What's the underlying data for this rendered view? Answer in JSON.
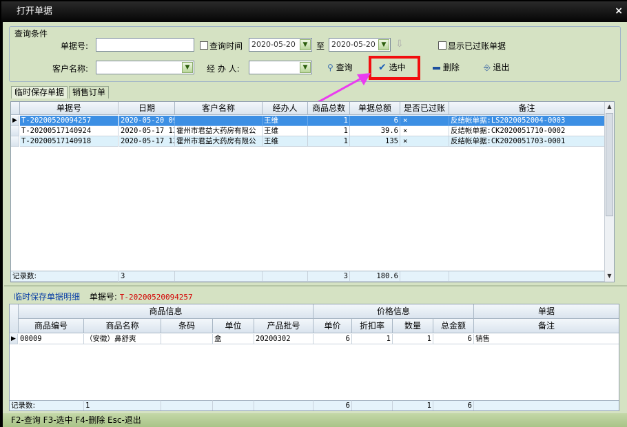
{
  "window": {
    "title": "打开单据",
    "close_glyph": "×"
  },
  "query": {
    "legend": "查询条件",
    "doc_no_label": "单据号:",
    "doc_no_value": "",
    "query_time_label": "查询时间",
    "date_from": "2020-05-20",
    "to_label": "至",
    "date_to": "2020-05-20",
    "show_posted_label": "显示已过账单据",
    "customer_label": "客户名称:",
    "customer_value": "",
    "handler_label": "经 办 人:",
    "handler_value": "",
    "btn_query": "查询",
    "btn_select": "选中",
    "btn_delete": "删除",
    "btn_exit": "退出"
  },
  "tabs": [
    "临时保存单据",
    "销售订单"
  ],
  "top_grid": {
    "headers": [
      "单据号",
      "日期",
      "客户名称",
      "经办人",
      "商品总数",
      "单据总额",
      "是否已过账",
      "备注"
    ],
    "rows": [
      [
        "T-20200520094257",
        "2020-05-20 09",
        "",
        "王维",
        "1",
        "6",
        "×",
        "反结帐单据:LS2020052004-0003"
      ],
      [
        "T-20200517140924",
        "2020-05-17 13",
        "霍州市君益大药房有限公",
        "王维",
        "1",
        "39.6",
        "×",
        "反结帐单据:CK2020051710-0002"
      ],
      [
        "T-20200517140918",
        "2020-05-17 13",
        "霍州市君益大药房有限公",
        "王维",
        "1",
        "135",
        "×",
        "反结帐单据:CK2020051703-0001"
      ]
    ],
    "footer": [
      "记录数:",
      "3",
      "",
      "",
      "3",
      "180.6",
      "",
      ""
    ]
  },
  "detail": {
    "title": "临时保存单据明细",
    "doc_label": "单据号:",
    "doc_value": "T-20200520094257",
    "group_headers": [
      "商品信息",
      "价格信息",
      "单据"
    ],
    "headers": [
      "商品编号",
      "商品名称",
      "条码",
      "单位",
      "产品批号",
      "单价",
      "折扣率",
      "数量",
      "总金额",
      "备注"
    ],
    "rows": [
      [
        "00009",
        "（安徽）鼻舒爽",
        "",
        "盒",
        "20200302",
        "6",
        "1",
        "1",
        "6",
        "销售"
      ]
    ],
    "footer": [
      "记录数:",
      "1",
      "",
      "",
      "",
      "6",
      "",
      "1",
      "6",
      ""
    ]
  },
  "status_bar": "F2-查询 F3-选中 F4-删除 Esc-退出",
  "colors": {
    "highlight": "#f20e0e",
    "arrow": "#ea3cf0",
    "selected_row": "#3c8fe4",
    "doc_no_red": "#d40000"
  }
}
